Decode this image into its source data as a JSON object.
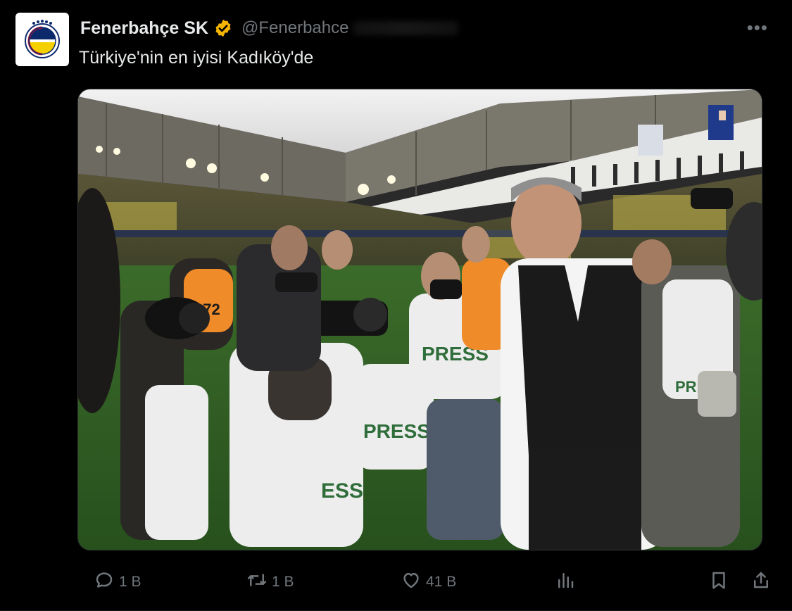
{
  "tweet": {
    "display_name": "Fenerbahçe SK",
    "handle": "@Fenerbahce",
    "text": "Türkiye'nin en iyisi Kadıköy'de",
    "more_label": "•••"
  },
  "photo": {
    "vest_texts": [
      "PRESS",
      "PRESS",
      "PRESS",
      "ESS"
    ],
    "bib_number": "072"
  },
  "actions": {
    "reply_count": "1 B",
    "retweet_count": "1 B",
    "like_count": "41 B"
  },
  "colors": {
    "background": "#000000",
    "text": "#e7e9ea",
    "muted": "#71767b",
    "verified_badge": "#f4b400",
    "club_yellow": "#f5d000",
    "club_navy": "#0c2a6b"
  }
}
